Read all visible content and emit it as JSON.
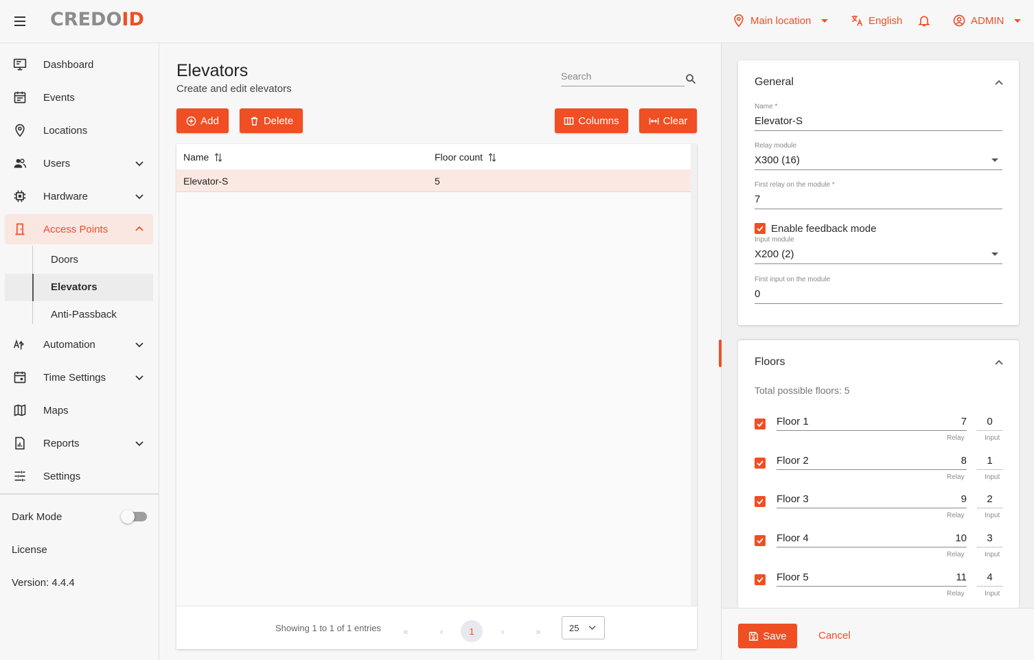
{
  "header": {
    "logo": {
      "part1": "CREDO",
      "part2": "ID"
    },
    "location": "Main location",
    "language": "English",
    "user": "ADMIN"
  },
  "sidebar": {
    "items": [
      {
        "label": "Dashboard",
        "icon": "monitor-icon"
      },
      {
        "label": "Events",
        "icon": "events-icon"
      },
      {
        "label": "Locations",
        "icon": "location-pin-icon"
      },
      {
        "label": "Users",
        "icon": "users-icon"
      },
      {
        "label": "Hardware",
        "icon": "chip-icon"
      },
      {
        "label": "Access Points",
        "icon": "door-icon"
      },
      {
        "label": "Automation",
        "icon": "automation-icon"
      },
      {
        "label": "Time Settings",
        "icon": "calendar-icon"
      },
      {
        "label": "Maps",
        "icon": "map-icon"
      },
      {
        "label": "Reports",
        "icon": "report-icon"
      },
      {
        "label": "Settings",
        "icon": "sliders-icon"
      }
    ],
    "sub_items": [
      "Doors",
      "Elevators",
      "Anti-Passback"
    ],
    "dark_mode": "Dark Mode",
    "dark_mode_on": false,
    "license": "License",
    "version": "Version: 4.4.4"
  },
  "main": {
    "title": "Elevators",
    "subtitle": "Create and edit elevators",
    "search_placeholder": "Search",
    "buttons": {
      "add": "Add",
      "delete": "Delete",
      "columns": "Columns",
      "clear": "Clear"
    },
    "table": {
      "columns": [
        "Name",
        "Floor count"
      ],
      "rows": [
        {
          "name": "Elevator-S",
          "floor_count": "5"
        }
      ]
    },
    "footer": {
      "showing": "Showing 1 to 1 of 1 entries",
      "first": "«",
      "prev": "‹",
      "page": "1",
      "next": "›",
      "last": "»",
      "page_size": "25"
    }
  },
  "panel": {
    "general": {
      "title": "General",
      "name_label": "Name *",
      "name_value": "Elevator-S",
      "relay_module_label": "Relay module",
      "relay_module_value": "X300 (16)",
      "first_relay_label": "First relay on the module *",
      "first_relay_value": "7",
      "feedback_label": "Enable feedback mode",
      "feedback_checked": true,
      "input_module_label": "Input module",
      "input_module_value": "X200 (2)",
      "first_input_label": "First input on the module",
      "first_input_value": "0"
    },
    "floors": {
      "title": "Floors",
      "total": "Total possible floors: 5",
      "relay_label": "Relay",
      "input_label": "Input",
      "items": [
        {
          "name": "Floor 1",
          "relay": "7",
          "input": "0",
          "checked": true
        },
        {
          "name": "Floor 2",
          "relay": "8",
          "input": "1",
          "checked": true
        },
        {
          "name": "Floor 3",
          "relay": "9",
          "input": "2",
          "checked": true
        },
        {
          "name": "Floor 4",
          "relay": "10",
          "input": "3",
          "checked": true
        },
        {
          "name": "Floor 5",
          "relay": "11",
          "input": "4",
          "checked": true
        }
      ]
    },
    "save": "Save",
    "cancel": "Cancel"
  },
  "colors": {
    "accent": "#f04e23",
    "row_selected": "#fbe8e3"
  }
}
